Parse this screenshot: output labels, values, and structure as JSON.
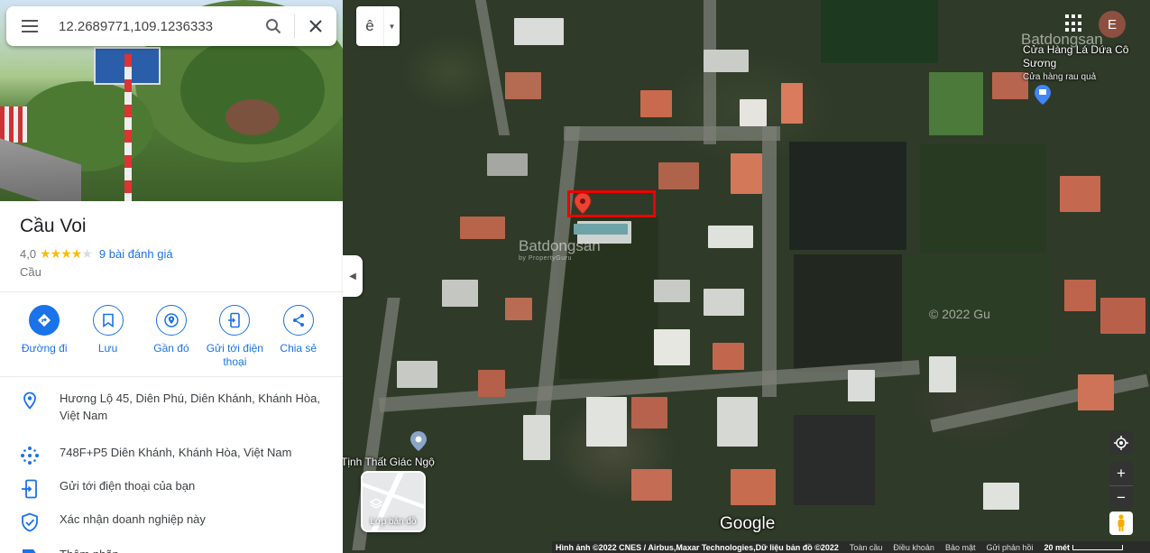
{
  "search": {
    "value": "12.2689771,109.1236333"
  },
  "place": {
    "title": "Cầu Voi",
    "rating": "4,0",
    "stars_filled": 4,
    "stars_total": 5,
    "reviews_label": "9 bài đánh giá",
    "category": "Cầu"
  },
  "actions": [
    {
      "label": "Đường đi",
      "icon": "directions-icon"
    },
    {
      "label": "Lưu",
      "icon": "bookmark-icon"
    },
    {
      "label": "Gần đó",
      "icon": "nearby-icon"
    },
    {
      "label": "Gửi tới điện thoại",
      "icon": "send-to-phone-icon"
    },
    {
      "label": "Chia sẻ",
      "icon": "share-icon"
    }
  ],
  "details": [
    {
      "text": "Hương Lộ 45, Diên Phú, Diên Khánh, Khánh Hòa, Việt Nam",
      "icon": "location-pin-icon"
    },
    {
      "text": "748F+P5 Diên Khánh, Khánh Hòa, Việt Nam",
      "icon": "plus-code-icon"
    },
    {
      "text": "Gửi tới điện thoại của bạn",
      "icon": "send-to-phone-icon"
    },
    {
      "text": "Xác nhận doanh nghiệp này",
      "icon": "verified-shield-icon"
    },
    {
      "text": "Thêm nhãn",
      "icon": "label-icon"
    }
  ],
  "map": {
    "layer_toggle_label": "ê",
    "avatar_letter": "E",
    "layers_button_label": "Lớp bản đồ",
    "google_logo": "Google",
    "pois": [
      {
        "name": "Cửa Hàng Lá Dứa Cô Sương",
        "sub": "Cửa hàng rau quả"
      },
      {
        "name": "Tịnh Thất Giác Ngộ"
      }
    ],
    "watermarks": {
      "brand": "Batdongsan",
      "tagline": "by PropertyGuru",
      "copyright": "© 2022 Gu"
    }
  },
  "footer": {
    "attribution": "Hình ảnh ©2022 CNES / Airbus,Maxar Technologies,Dữ liệu bản đồ ©2022",
    "links": [
      "Toàn cầu",
      "Điều khoản",
      "Bảo mật",
      "Gửi phản hồi"
    ],
    "scale": "20 mét"
  },
  "colors": {
    "accent": "#1a73e8",
    "star": "#fbbc04",
    "marker": "#ea4335",
    "highlight_box": "#e00000"
  }
}
